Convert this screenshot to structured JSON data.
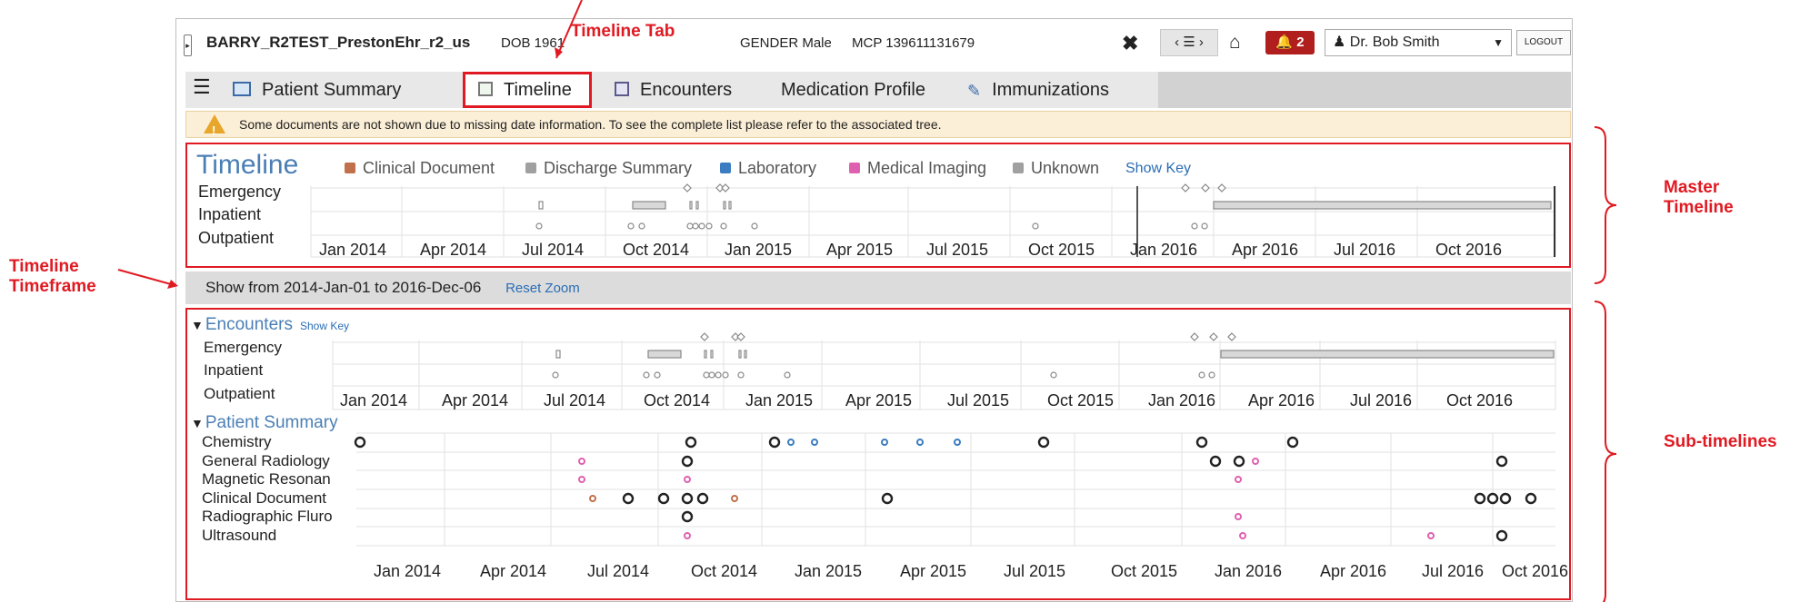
{
  "patient": {
    "name": "BARRY_R2TEST_PrestonEhr_r2_us",
    "dob": "DOB 1961",
    "gender": "GENDER Male",
    "mcp": "MCP 139611131679"
  },
  "header": {
    "close": "✖",
    "list": "‹ ☰ ›",
    "home": "⌂",
    "alert_count": "2",
    "user": "Dr. Bob Smith",
    "logout": "LOGOUT"
  },
  "tabs": [
    {
      "label": "Patient Summary"
    },
    {
      "label": "Timeline"
    },
    {
      "label": "Encounters"
    },
    {
      "label": "Medication Profile"
    },
    {
      "label": "Immunizations"
    }
  ],
  "warning": "Some documents are not shown due to missing date information. To see the complete list please refer to the associated tree.",
  "master": {
    "title": "Timeline",
    "legend": [
      {
        "label": "Clinical Document",
        "color": "#c0704a"
      },
      {
        "label": "Discharge Summary",
        "color": "#a0a0a0"
      },
      {
        "label": "Laboratory",
        "color": "#3c7cc0"
      },
      {
        "label": "Medical Imaging",
        "color": "#e060b0"
      },
      {
        "label": "Unknown",
        "color": "#a0a0a0"
      }
    ],
    "show_key": "Show Key",
    "rows": [
      "Emergency",
      "Inpatient",
      "Outpatient"
    ],
    "axis": [
      "Jan 2014",
      "Apr 2014",
      "Jul 2014",
      "Oct 2014",
      "Jan 2015",
      "Apr 2015",
      "Jul 2015",
      "Oct 2015",
      "Jan 2016",
      "Apr 2016",
      "Jul 2016",
      "Oct 2016"
    ]
  },
  "timeframe": {
    "text": "Show from 2014-Jan-01 to 2016-Dec-06",
    "reset": "Reset Zoom"
  },
  "encounters": {
    "title": "Encounters",
    "show_key": "Show Key",
    "rows": [
      "Emergency",
      "Inpatient",
      "Outpatient"
    ]
  },
  "patient_summary": {
    "title": "Patient Summary",
    "rows": [
      "Chemistry",
      "General Radiology",
      "Magnetic Resonan",
      "Clinical Document",
      "Radiographic Fluro",
      "Ultrasound"
    ]
  },
  "annotations": {
    "timeline_tab": "Timeline Tab",
    "master_line1": "Master",
    "master_line2": "Timeline",
    "timeframe_line1": "Timeline",
    "timeframe_line2": "Timeframe",
    "sub": "Sub-timelines"
  },
  "colors": {
    "accent": "#e01a22",
    "link": "#2a6db5",
    "title_blue": "#4a7fb5",
    "alert": "#b01e1e",
    "warning_bg": "#fcefd7"
  }
}
